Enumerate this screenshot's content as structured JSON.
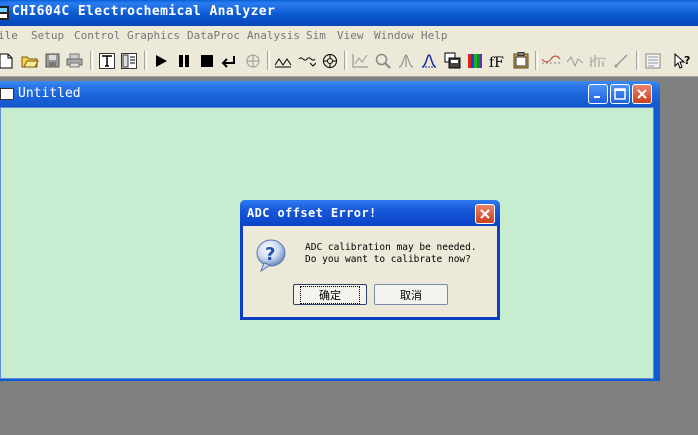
{
  "app": {
    "title": "CHI604C Electrochemical Analyzer"
  },
  "menu": {
    "items": [
      "ile",
      "Setup",
      "Control",
      "Graphics",
      "DataProc",
      "Analysis",
      "Sim",
      "View",
      "Window",
      "Help"
    ]
  },
  "toolbar": {
    "icons": [
      "new-file-icon",
      "open-folder-icon",
      "save-icon",
      "print-icon",
      "technique-icon",
      "parameters-icon",
      "run-icon",
      "pause-icon",
      "stop-icon",
      "reverse-scan-icon",
      "scan-direction-icon",
      "ir-comp-icon",
      "filter-icon",
      "cell-control-icon",
      "graph-options-icon",
      "zoom-icon",
      "peak-icon",
      "baseline-icon",
      "overlay-icon",
      "color-icon",
      "font-icon",
      "clipboard-icon",
      "smooth-icon",
      "derivative-icon",
      "integrate-icon",
      "fit-icon",
      "notepad-icon",
      "help-pointer-icon"
    ]
  },
  "child_window": {
    "title": "Untitled",
    "client_color": "#c8ecd0"
  },
  "dialog": {
    "title": "ADC offset Error!",
    "message_line1": "ADC calibration may be needed.",
    "message_line2": "Do you want to calibrate now?",
    "ok_label": "确定",
    "cancel_label": "取消"
  },
  "colors": {
    "titlebar": "#0b59d0",
    "desktop": "#808080",
    "dialog_face": "#ece9d8"
  }
}
